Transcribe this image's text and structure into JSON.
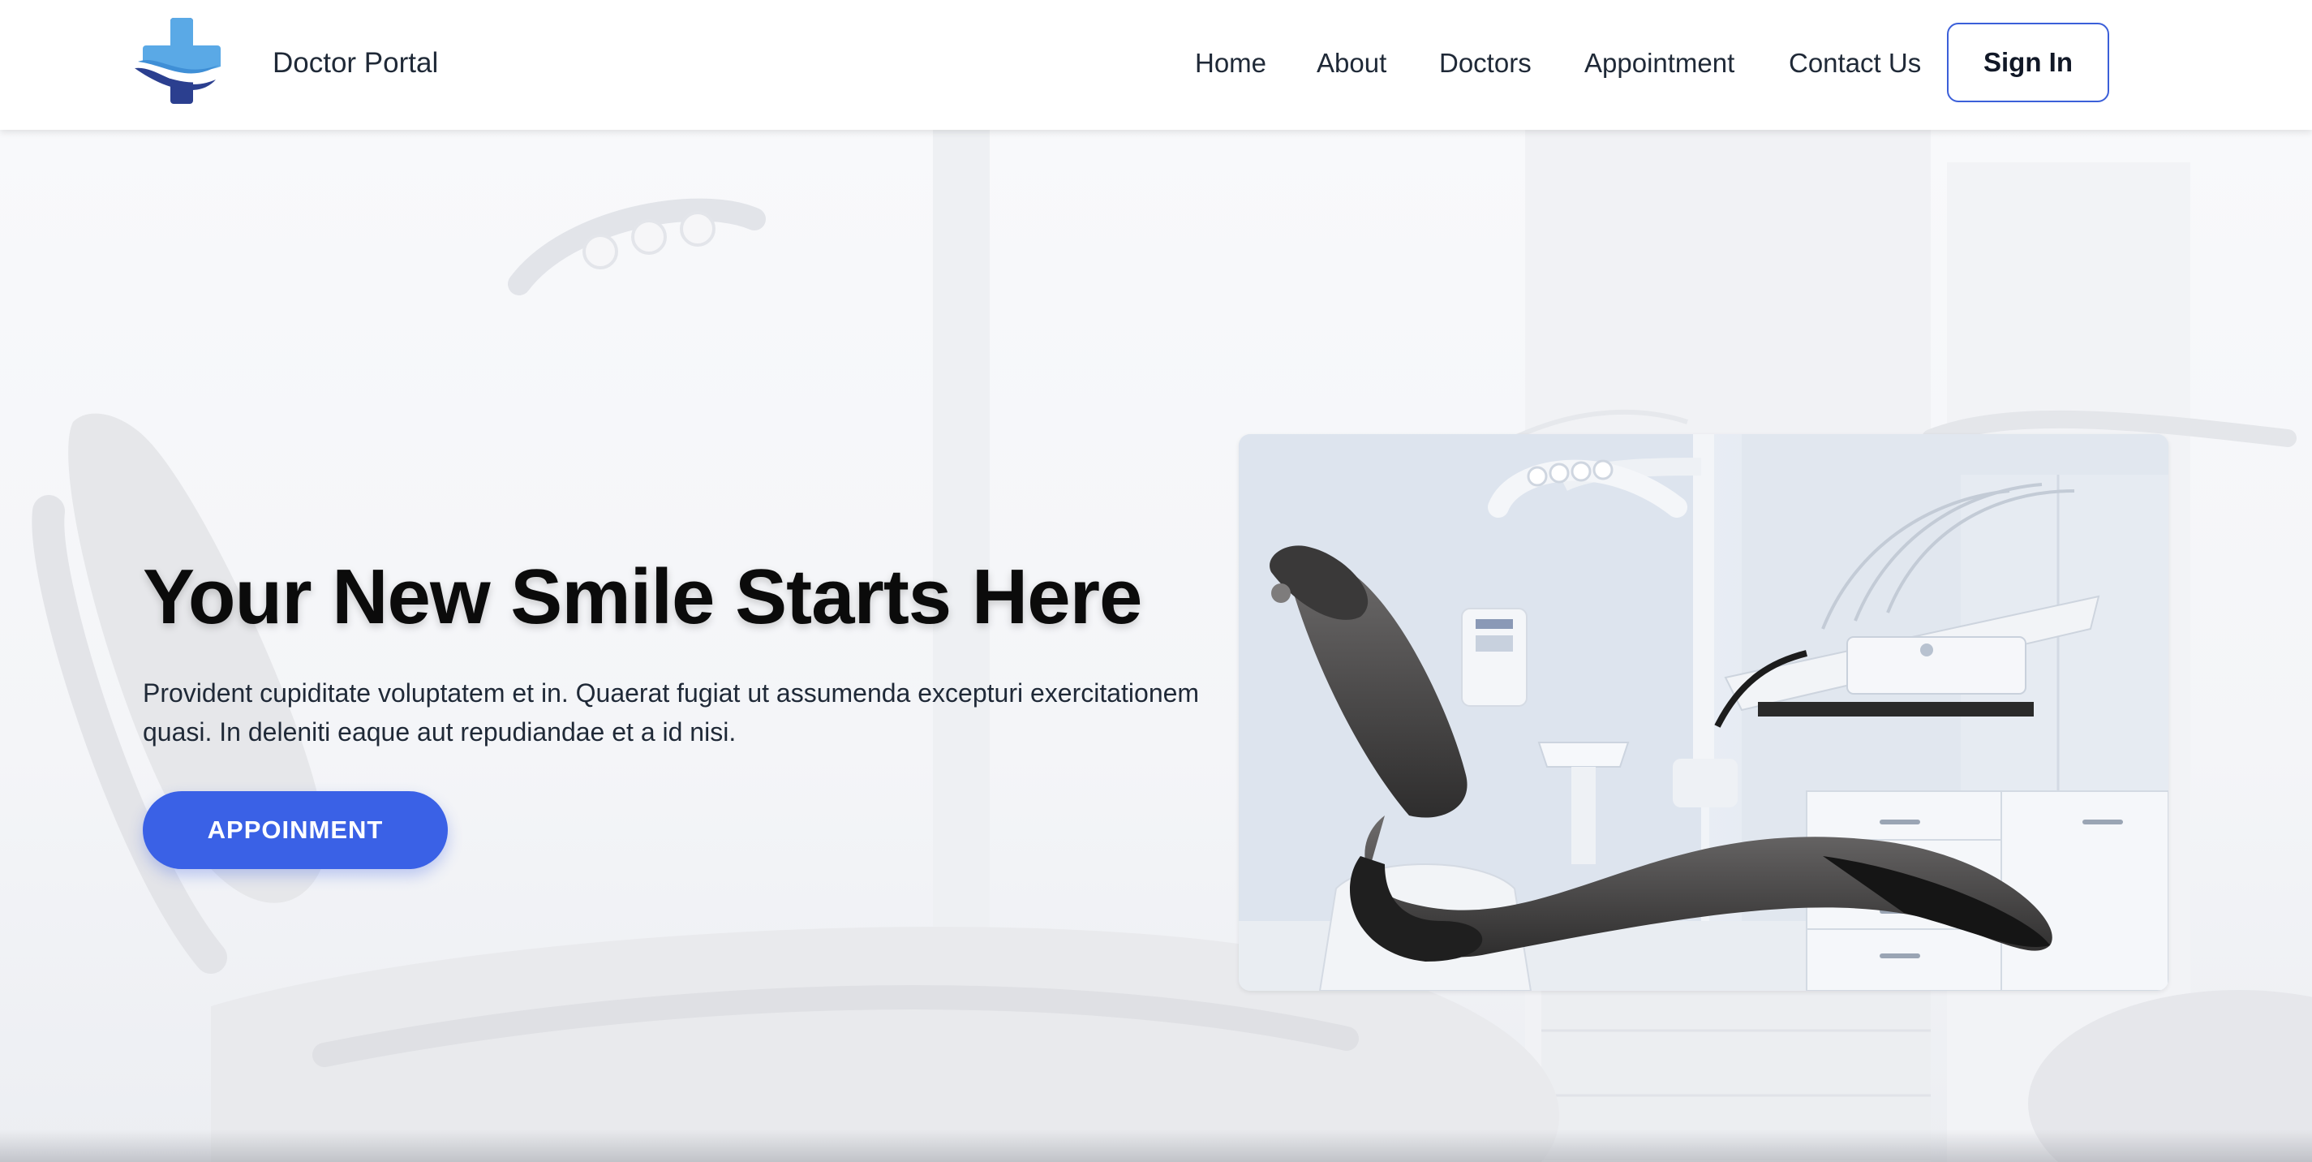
{
  "header": {
    "brand": "Doctor Portal",
    "logo_icon": "medical-cross-wave-icon",
    "nav": [
      {
        "label": "Home"
      },
      {
        "label": "About"
      },
      {
        "label": "Doctors"
      },
      {
        "label": "Appointment"
      },
      {
        "label": "Contact Us"
      }
    ],
    "signin_label": "Sign In"
  },
  "hero": {
    "title": "Your New Smile Starts Here",
    "description": "Provident cupiditate voluptatem et in. Quaerat fugiat ut assumenda excepturi exercitationem quasi. In deleniti eaque aut repudiandae et a id nisi.",
    "cta_label": "APPOINMENT",
    "image_subject": "dental-chair-clinic-photo",
    "background_subject": "faded-dental-chair-background"
  },
  "colors": {
    "accent": "#3a61e6",
    "border_accent": "#3b5fd9",
    "logo_light": "#5aa9e6",
    "logo_dark": "#2b3f8f",
    "text_dark": "#1f2937"
  }
}
